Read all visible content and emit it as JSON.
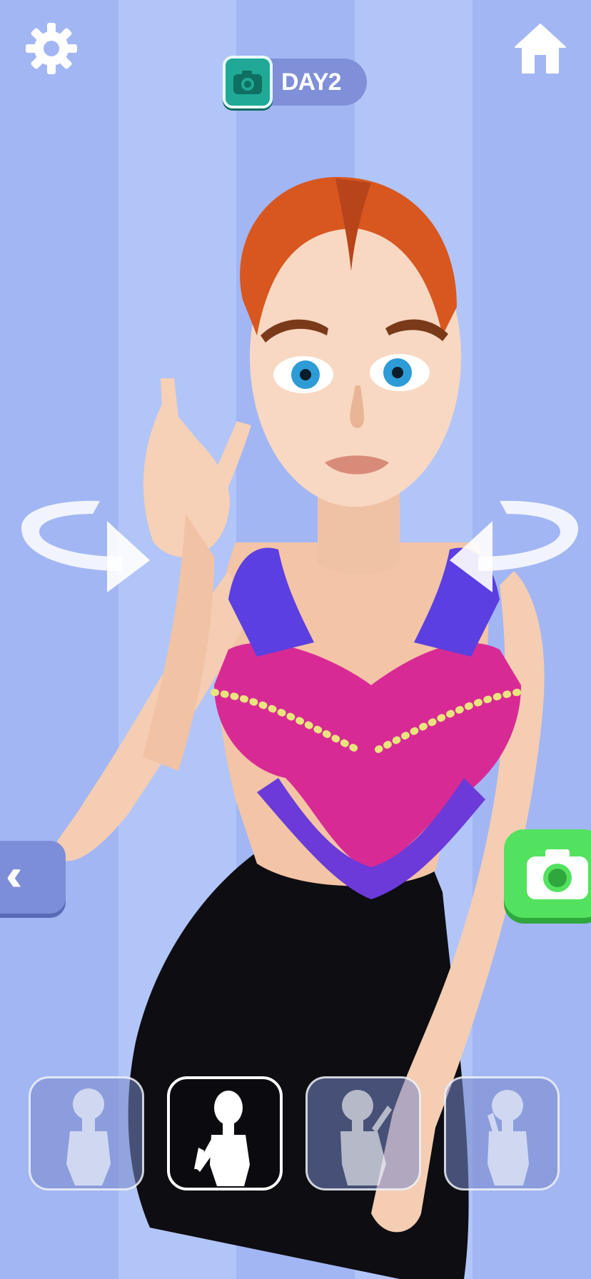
{
  "header": {
    "day_label": "DAY2"
  },
  "icons": {
    "settings": "gear-icon",
    "home": "home-icon",
    "day_camera": "camera-icon",
    "back": "double-chevron-left-icon",
    "photo": "camera-icon"
  },
  "poses": {
    "items": [
      {
        "name": "pose-1",
        "selected": false
      },
      {
        "name": "pose-2",
        "selected": true
      },
      {
        "name": "pose-3",
        "selected": false
      },
      {
        "name": "pose-4",
        "selected": false
      }
    ]
  },
  "colors": {
    "background_stripe_a": "#a2b6f4",
    "background_stripe_b": "#b2c5f8",
    "day_pill": "#7f8fd8",
    "camera_badge": "#1fa996",
    "photo_button": "#53e25f",
    "back_button": "#7d8ed8"
  }
}
